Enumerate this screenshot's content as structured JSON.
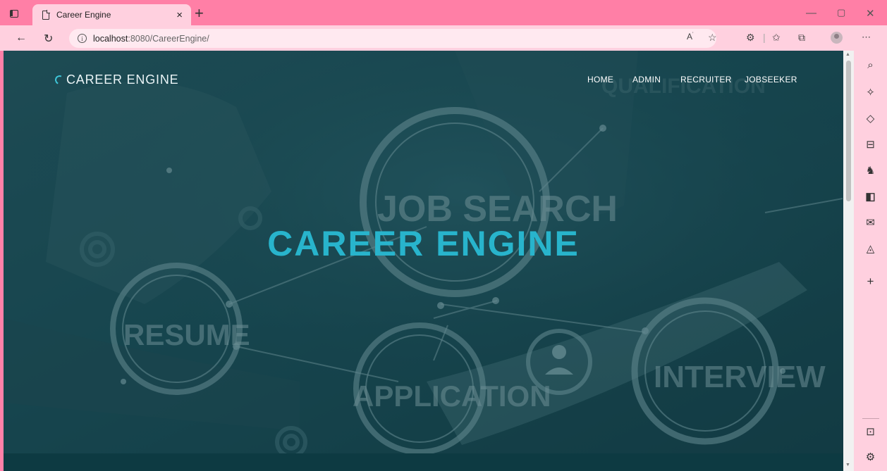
{
  "browser": {
    "tab_title": "Career Engine",
    "tab_close": "×",
    "new_tab": "+",
    "url_host": "localhost",
    "url_rest": ":8080/CareerEngine/",
    "controls": {
      "minimize": "—",
      "restore": "▢",
      "close": "✕"
    },
    "icons": [
      "read-aloud-icon",
      "favorite-add-icon",
      "extensions-icon",
      "favorites-icon",
      "collections-icon",
      "profile-icon",
      "more-icon"
    ]
  },
  "sidebar": {
    "icons": [
      "search-icon",
      "sparkle-icon",
      "tag-icon",
      "briefcase-icon",
      "games-icon",
      "office-icon",
      "outlook-icon",
      "bell-icon",
      "add-icon",
      "panel-icon",
      "settings-icon"
    ]
  },
  "site": {
    "brand": "CAREER ENGINE",
    "nav": [
      "HOME",
      "ADMIN",
      "RECRUITER",
      "JOBSEEKER"
    ],
    "hero_title": "CAREER ENGINE",
    "bg_words": [
      "JOB SEARCH",
      "RESUME",
      "APPLICATION",
      "INTERVIEW",
      "QUALIFICATION"
    ],
    "accent": "#28b4cc",
    "overlay": "#17444d"
  }
}
